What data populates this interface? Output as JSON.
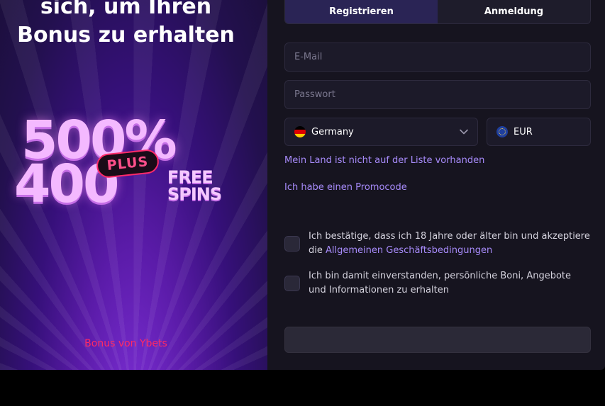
{
  "promo": {
    "title_line1": "sich, um Ihren",
    "title_line2": "Bonus zu erhalten",
    "percent": "500%",
    "plus": "PLUS",
    "spins_count": "400",
    "free": "FREE",
    "spins": "SPINS",
    "caption": "Bonus von Ybets"
  },
  "tabs": [
    {
      "label": "Registrieren",
      "active": true
    },
    {
      "label": "Anmeldung",
      "active": false
    }
  ],
  "form": {
    "email_placeholder": "E-Mail",
    "email_value": "",
    "password_placeholder": "Passwort",
    "password_value": "",
    "country": {
      "flag_icon": "germany-flag-icon",
      "value": "Germany"
    },
    "currency": {
      "flag_icon": "eu-flag-icon",
      "value": "EUR"
    },
    "link_country_missing": "Mein Land ist nicht auf der Liste vorhanden",
    "link_promocode": "Ich habe einen Promocode",
    "consent_terms_text": "Ich bestätige, dass ich 18 Jahre oder älter bin und akzeptiere die",
    "consent_terms_link": "Allgemeinen Geschäftsbedingungen",
    "consent_terms_checked": false,
    "consent_marketing_text": "Ich bin damit einverstanden, persönliche Boni, Angebote und Informationen zu erhalten",
    "consent_marketing_checked": false
  },
  "colors": {
    "accent_link": "#a78bfa",
    "promo_caption": "#ff2a64",
    "active_tab": "#2a2455",
    "panel_bg": "#16141f"
  }
}
